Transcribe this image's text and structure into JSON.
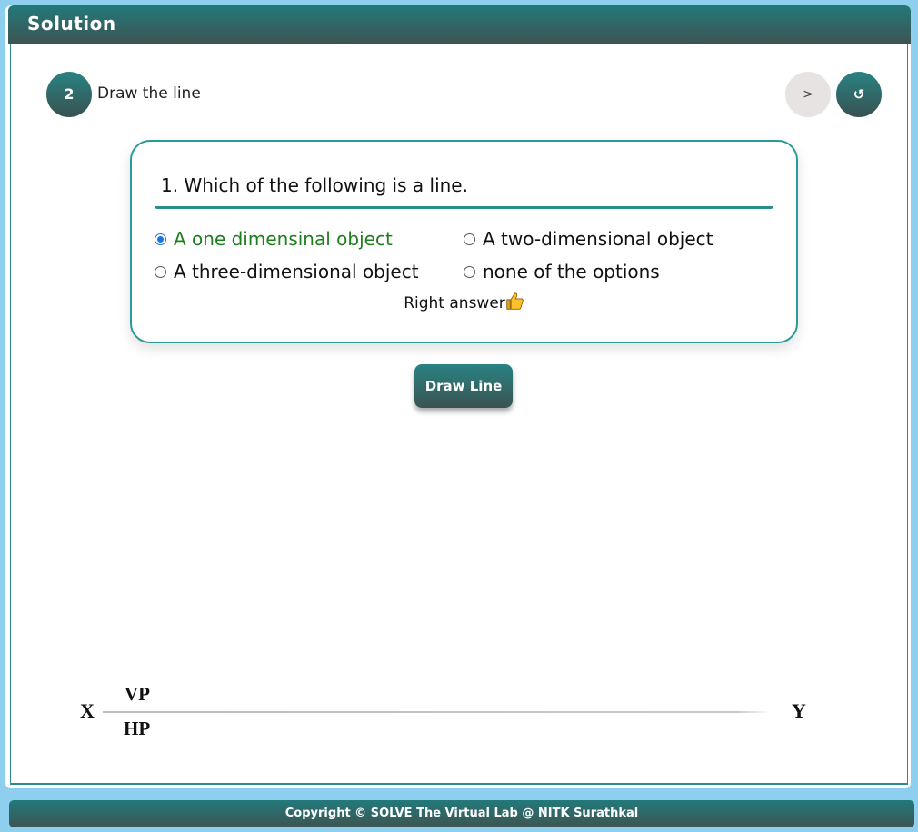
{
  "panel": {
    "title": "Solution"
  },
  "step": {
    "number": "2",
    "title": "Draw the line"
  },
  "nav": {
    "next_label": ">",
    "reset_label": "↺"
  },
  "quiz": {
    "question": "1. Which of the following is a line.",
    "options": [
      {
        "label": "A one dimensinal object",
        "selected": true
      },
      {
        "label": "A two-dimensional object",
        "selected": false
      },
      {
        "label": "A three-dimensional object",
        "selected": false
      },
      {
        "label": "none of the options",
        "selected": false
      }
    ],
    "feedback": "Right answer"
  },
  "actions": {
    "draw_line_label": "Draw Line"
  },
  "drawing": {
    "x_label": "X",
    "y_label": "Y",
    "vp_label": "VP",
    "hp_label": "HP"
  },
  "footer": {
    "text": "Copyright © SOLVE The Virtual Lab @ NITK Surathkal"
  },
  "colors": {
    "accent": "#2a8283",
    "selected_text": "#1e7e1e",
    "background": "#8ecff0"
  }
}
